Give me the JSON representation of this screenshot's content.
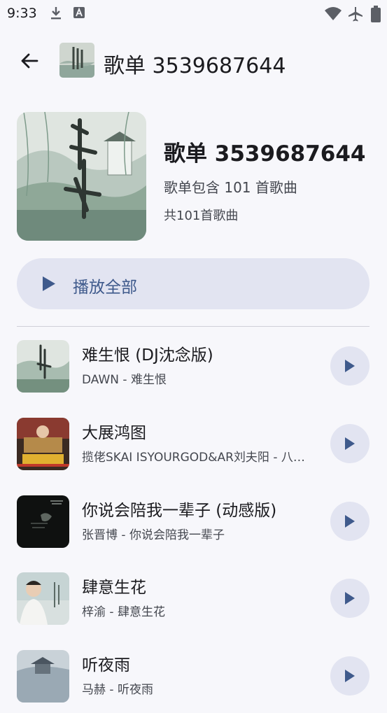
{
  "status_bar": {
    "time": "9:33",
    "icons": [
      "download-icon",
      "notification-a-icon",
      "wifi-icon",
      "airplane-mode-icon",
      "battery-icon"
    ]
  },
  "app_bar": {
    "title": "歌单 3539687644",
    "back_icon": "arrow-left-icon"
  },
  "header": {
    "title": "歌单 3539687644",
    "subtitle": "歌单包含 101 首歌曲",
    "count": "共101首歌曲"
  },
  "play_all": {
    "label": "播放全部",
    "icon": "play-icon"
  },
  "tracks": [
    {
      "title": "难生恨 (DJ沈念版)",
      "subtitle": "DAWN - 难生恨"
    },
    {
      "title": "大展鸿图",
      "subtitle": "揽佬SKAI ISYOURGOD&AR刘夫阳 - 八…"
    },
    {
      "title": "你说会陪我一辈子 (动感版)",
      "subtitle": "张晋博 - 你说会陪我一辈子"
    },
    {
      "title": "肆意生花",
      "subtitle": "梓渝 - 肆意生花"
    },
    {
      "title": "听夜雨",
      "subtitle": "马赫 - 听夜雨"
    }
  ],
  "colors": {
    "background": "#f7f7fb",
    "tonal_button": "#e2e4f1",
    "accent": "#3f5a8c",
    "text_primary": "#1b1b1f",
    "text_secondary": "#44474f"
  }
}
